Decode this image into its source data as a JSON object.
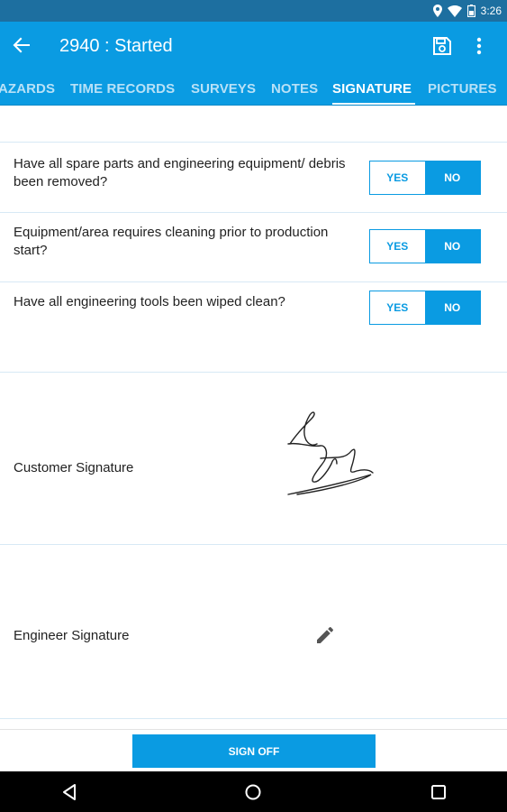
{
  "status_bar": {
    "time": "3:26",
    "icons": [
      "location-icon",
      "wifi-icon",
      "battery-icon"
    ]
  },
  "app_bar": {
    "title": "2940 : Started",
    "icons": [
      "back-arrow-icon",
      "save-icon",
      "more-vert-icon"
    ]
  },
  "tabs": [
    {
      "label": "AZARDS",
      "active": false
    },
    {
      "label": "TIME RECORDS",
      "active": false
    },
    {
      "label": "SURVEYS",
      "active": false
    },
    {
      "label": "NOTES",
      "active": false
    },
    {
      "label": "SIGNATURE",
      "active": true
    },
    {
      "label": "PICTURES",
      "active": false
    }
  ],
  "questions": [
    {
      "text": "Have all spare parts and engineering equipment/ debris been removed?",
      "yes_label": "YES",
      "no_label": "NO",
      "selected": "NO"
    },
    {
      "text": "Equipment/area requires cleaning prior to production start?",
      "yes_label": "YES",
      "no_label": "NO",
      "selected": "NO"
    },
    {
      "text": "Have all engineering tools been wiped clean?",
      "yes_label": "YES",
      "no_label": "NO",
      "selected": "NO"
    }
  ],
  "signatures": {
    "customer_label": "Customer Signature",
    "engineer_label": "Engineer Signature"
  },
  "footer": {
    "sign_off_label": "SIGN OFF"
  },
  "colors": {
    "accent": "#0a9be2",
    "status_bar": "#1d6fa0",
    "nav_bar": "#000000"
  }
}
